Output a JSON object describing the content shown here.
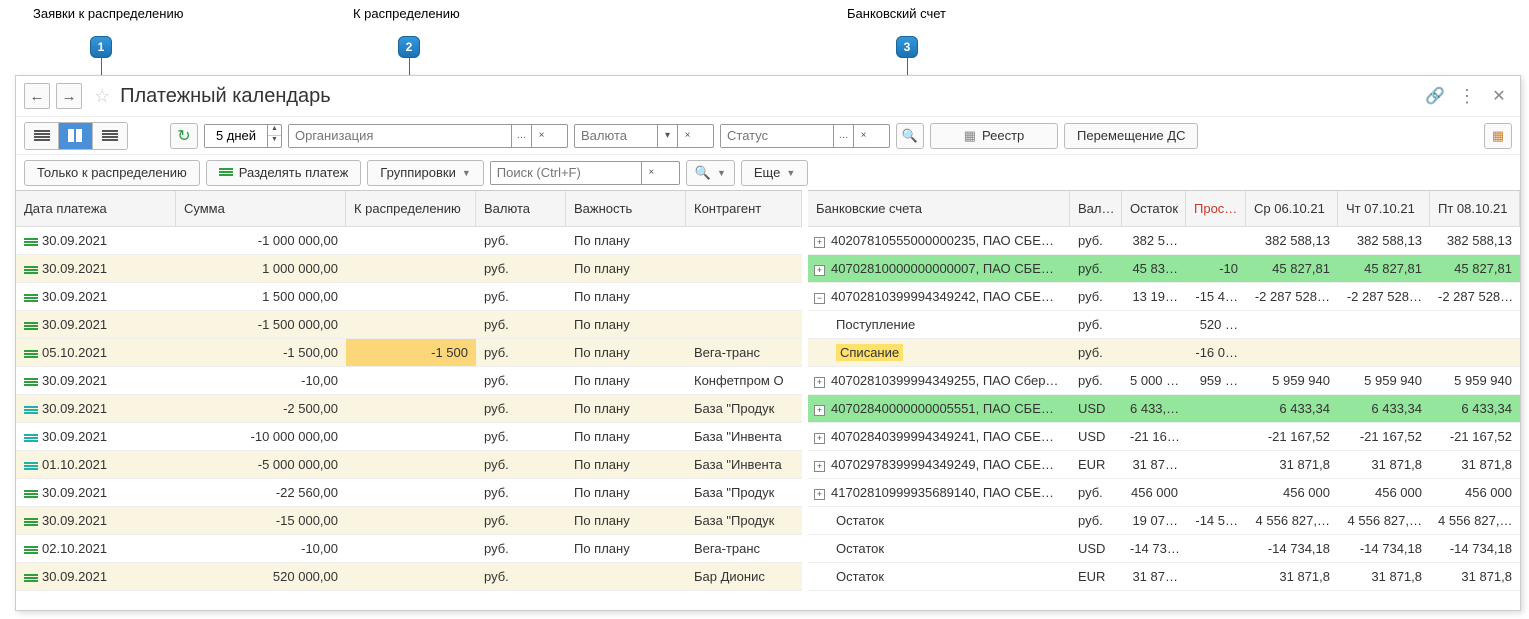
{
  "callouts": {
    "c1": "Заявки к распределению",
    "c2": "К распределению",
    "c3": "Банковский счет"
  },
  "title": "Платежный календарь",
  "toolbar": {
    "days": "5 дней",
    "org_ph": "Организация",
    "currency_ph": "Валюта",
    "status_ph": "Статус",
    "reestr": "Реестр",
    "move": "Перемещение ДС"
  },
  "filterbar": {
    "only_dist": "Только к распределению",
    "split_pay": "Разделять платеж",
    "groupings": "Группировки",
    "search_ph": "Поиск (Ctrl+F)",
    "more": "Еще"
  },
  "left": {
    "headers": {
      "date": "Дата платежа",
      "sum": "Сумма",
      "dist": "К распределению",
      "curr": "Валюта",
      "importance": "Важность",
      "counterparty": "Контрагент"
    },
    "rows": [
      {
        "k": "g",
        "d": "30.09.2021",
        "s": "-1 000 000,00",
        "dist": "",
        "c": "руб.",
        "i": "По плану",
        "cp": "",
        "cls": "row-light"
      },
      {
        "k": "g",
        "d": "30.09.2021",
        "s": "1 000 000,00",
        "dist": "",
        "c": "руб.",
        "i": "По плану",
        "cp": "",
        "cls": "row-beige"
      },
      {
        "k": "g",
        "d": "30.09.2021",
        "s": "1 500 000,00",
        "dist": "",
        "c": "руб.",
        "i": "По плану",
        "cp": "",
        "cls": "row-light"
      },
      {
        "k": "g",
        "d": "30.09.2021",
        "s": "-1 500 000,00",
        "dist": "",
        "c": "руб.",
        "i": "По плану",
        "cp": "",
        "cls": "row-beige"
      },
      {
        "k": "g",
        "d": "05.10.2021",
        "s": "-1 500,00",
        "dist": "-1 500",
        "c": "руб.",
        "i": "По плану",
        "cp": "Вега-транс",
        "cls": "row-beige",
        "hl": true
      },
      {
        "k": "g",
        "d": "30.09.2021",
        "s": "-10,00",
        "dist": "",
        "c": "руб.",
        "i": "По плану",
        "cp": "Конфетпром О",
        "cls": "row-light"
      },
      {
        "k": "t",
        "d": "30.09.2021",
        "s": "-2 500,00",
        "dist": "",
        "c": "руб.",
        "i": "По плану",
        "cp": "База \"Продук",
        "cls": "row-beige"
      },
      {
        "k": "t",
        "d": "30.09.2021",
        "s": "-10 000 000,00",
        "dist": "",
        "c": "руб.",
        "i": "По плану",
        "cp": "База \"Инвента",
        "cls": "row-light"
      },
      {
        "k": "t",
        "d": "01.10.2021",
        "s": "-5 000 000,00",
        "dist": "",
        "c": "руб.",
        "i": "По плану",
        "cp": "База \"Инвента",
        "cls": "row-beige"
      },
      {
        "k": "g",
        "d": "30.09.2021",
        "s": "-22 560,00",
        "dist": "",
        "c": "руб.",
        "i": "По плану",
        "cp": "База \"Продук",
        "cls": "row-light"
      },
      {
        "k": "g",
        "d": "30.09.2021",
        "s": "-15 000,00",
        "dist": "",
        "c": "руб.",
        "i": "По плану",
        "cp": "База \"Продук",
        "cls": "row-beige"
      },
      {
        "k": "g",
        "d": "02.10.2021",
        "s": "-10,00",
        "dist": "",
        "c": "руб.",
        "i": "По плану",
        "cp": "Вега-транс",
        "cls": "row-light"
      },
      {
        "k": "g",
        "d": "30.09.2021",
        "s": "520 000,00",
        "dist": "",
        "c": "руб.",
        "i": "",
        "cp": "Бар Дионис",
        "cls": "row-beige"
      }
    ]
  },
  "right": {
    "headers": {
      "acct": "Банковские счета",
      "curr": "Вал…",
      "balance": "Остаток",
      "pros": "Прос…",
      "d1": "Ср 06.10.21",
      "d2": "Чт 07.10.21",
      "d3": "Пт 08.10.21"
    },
    "rows": [
      {
        "exp": "+",
        "ind": 0,
        "a": "40207810555000000235, ПАО СБЕ…",
        "c": "руб.",
        "b": "382 5…",
        "p": "",
        "d1": "382 588,13",
        "d2": "382 588,13",
        "d3": "382 588,13",
        "cls": "row-light"
      },
      {
        "exp": "+",
        "ind": 0,
        "a": "40702810000000000007, ПАО СБЕ…",
        "c": "руб.",
        "b": "45 83…",
        "p": "-10",
        "d1": "45 827,81",
        "d2": "45 827,81",
        "d3": "45 827,81",
        "cls": "row-green",
        "pn": true
      },
      {
        "exp": "−",
        "ind": 0,
        "a": "40702810399994349242, ПАО СБЕ…",
        "c": "руб.",
        "b": "13 19…",
        "p": "-15 4…",
        "d1": "-2 287 528…",
        "d2": "-2 287 528…",
        "d3": "-2 287 528…",
        "cls": "row-light",
        "pn": true,
        "dn": true
      },
      {
        "exp": "",
        "ind": 1,
        "a": "Поступление",
        "c": "руб.",
        "b": "",
        "p": "520 …",
        "d1": "",
        "d2": "",
        "d3": "",
        "cls": "row-light",
        "pn": true
      },
      {
        "exp": "",
        "ind": 1,
        "a": "Списание",
        "c": "руб.",
        "b": "",
        "p": "-16 0…",
        "d1": "",
        "d2": "",
        "d3": "",
        "cls": "row-beige",
        "pn": true,
        "box": true
      },
      {
        "exp": "+",
        "ind": 0,
        "a": "40702810399994349255, ПАО Сбер…",
        "c": "руб.",
        "b": "5 000 …",
        "p": "959 …",
        "d1": "5 959 940",
        "d2": "5 959 940",
        "d3": "5 959 940",
        "cls": "row-light",
        "pn": true
      },
      {
        "exp": "+",
        "ind": 0,
        "a": "40702840000000005551, ПАО СБЕ…",
        "c": "USD",
        "b": "6 433,…",
        "p": "",
        "d1": "6 433,34",
        "d2": "6 433,34",
        "d3": "6 433,34",
        "cls": "row-green"
      },
      {
        "exp": "+",
        "ind": 0,
        "a": "40702840399994349241, ПАО СБЕ…",
        "c": "USD",
        "b": "-21 16…",
        "p": "",
        "d1": "-21 167,52",
        "d2": "-21 167,52",
        "d3": "-21 167,52",
        "cls": "row-light",
        "dn": true
      },
      {
        "exp": "+",
        "ind": 0,
        "a": "40702978399994349249, ПАО СБЕ…",
        "c": "EUR",
        "b": "31 87…",
        "p": "",
        "d1": "31 871,8",
        "d2": "31 871,8",
        "d3": "31 871,8",
        "cls": "row-light"
      },
      {
        "exp": "+",
        "ind": 0,
        "a": "41702810999935689140, ПАО СБЕ…",
        "c": "руб.",
        "b": "456 000",
        "p": "",
        "d1": "456 000",
        "d2": "456 000",
        "d3": "456 000",
        "cls": "row-light"
      },
      {
        "exp": "",
        "ind": 1,
        "a": "Остаток",
        "c": "руб.",
        "b": "19 07…",
        "p": "-14 5…",
        "d1": "4 556 827,…",
        "d2": "4 556 827,…",
        "d3": "4 556 827,…",
        "cls": "row-light",
        "pn": true
      },
      {
        "exp": "",
        "ind": 1,
        "a": "Остаток",
        "c": "USD",
        "b": "-14 73…",
        "p": "",
        "d1": "-14 734,18",
        "d2": "-14 734,18",
        "d3": "-14 734,18",
        "cls": "row-light",
        "dn": true
      },
      {
        "exp": "",
        "ind": 1,
        "a": "Остаток",
        "c": "EUR",
        "b": "31 87…",
        "p": "",
        "d1": "31 871,8",
        "d2": "31 871,8",
        "d3": "31 871,8",
        "cls": "row-light"
      }
    ]
  }
}
